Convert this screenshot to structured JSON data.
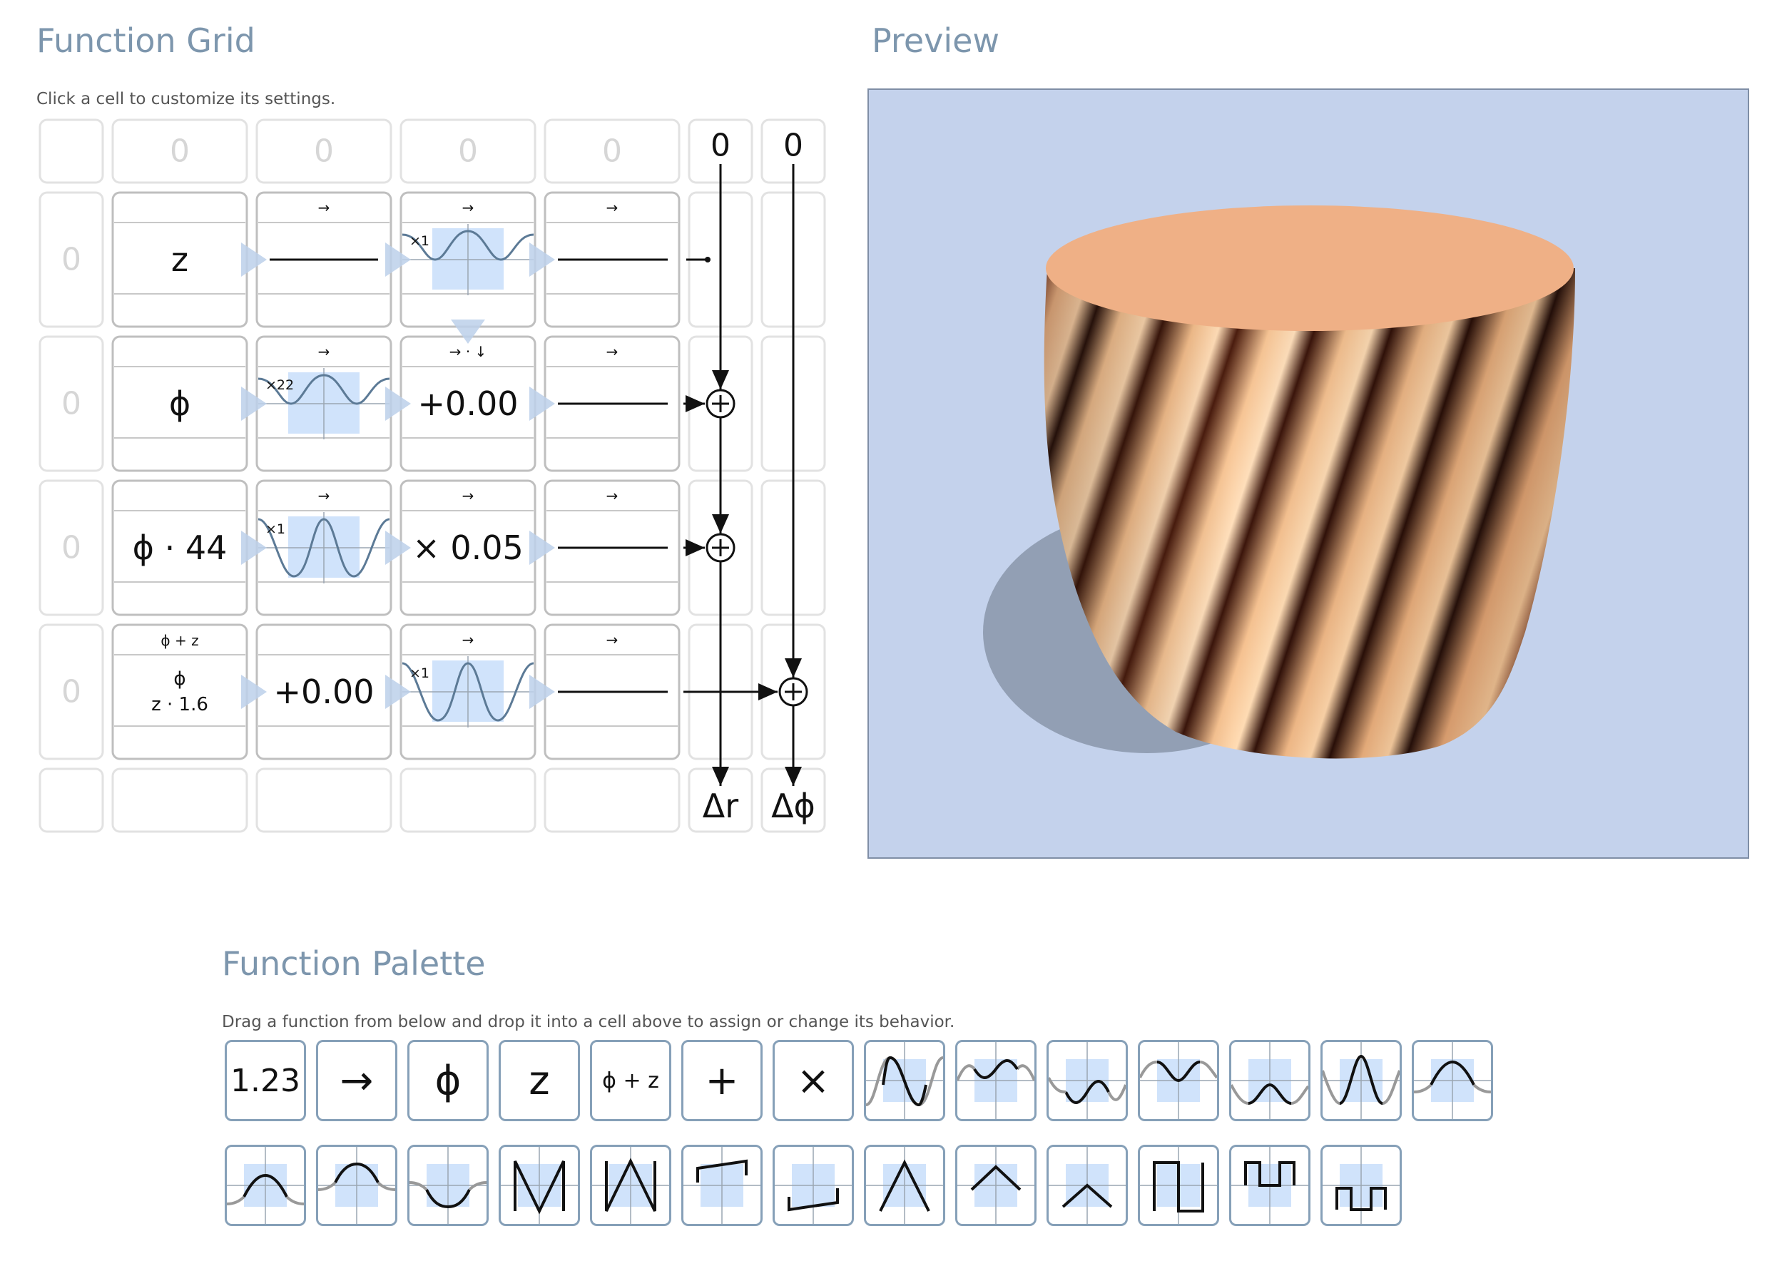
{
  "grid": {
    "title": "Function Grid",
    "hint": "Click a cell to customize its settings.",
    "header_values": [
      "0",
      "0",
      "0",
      "0"
    ],
    "row_values": [
      "0",
      "0",
      "0",
      "0"
    ],
    "out_col_top": [
      "0",
      "0"
    ],
    "rows": [
      {
        "input": "z",
        "col2": "wave",
        "col2_mult": "",
        "col3": "wave",
        "col3_mult": "×1",
        "col3_top": "→"
      },
      {
        "input": "ϕ",
        "col2": "wave",
        "col2_mult": "×22",
        "col3": "+0.00",
        "col3_top": "→ · ↓"
      },
      {
        "input": "ϕ · 44",
        "col2": "wave",
        "col2_mult": "×1",
        "col3": "× 0.05",
        "col3_top": "→"
      },
      {
        "input_top": "ϕ + z",
        "input_line1": "ϕ",
        "input_line2": "z · 1.6",
        "col2": "+0.00",
        "col3": "wave",
        "col3_mult": "×1",
        "col3_top": "→"
      }
    ],
    "arrow_label": "→",
    "outputs": [
      "Δr",
      "Δϕ"
    ]
  },
  "preview": {
    "title": "Preview",
    "background": "#c4d2ec",
    "object_color": "#efb086"
  },
  "palette": {
    "title": "Function Palette",
    "hint": "Drag a function from below and drop it into a cell above to assign or change its behavior.",
    "text_items": [
      "1.23",
      "→",
      "ϕ",
      "z",
      "ϕ + z",
      "+",
      "×"
    ],
    "row1_icons": [
      "sine-full-icon",
      "cosine-bump-icon",
      "cosine-dip-icon",
      "abs-cos-icon",
      "inverted-bump-icon",
      "sine-peak-icon",
      "cosine-wave-icon"
    ],
    "row2_icons": [
      "sine-trough-icon",
      "arch-icon",
      "bowl-icon",
      "sawtooth-up-icon",
      "sawtooth-down-icon",
      "ramp-step-icon",
      "ramp-low-icon",
      "triangle-peak-icon",
      "tent-icon",
      "wedge-icon",
      "square-wave-icon",
      "square-pulse-icon",
      "square-low-icon"
    ]
  },
  "colors": {
    "accent": "#7d96ad",
    "highlight": "#d0e3fb",
    "wave": "#5c7a96",
    "border": "#86a0b8"
  }
}
